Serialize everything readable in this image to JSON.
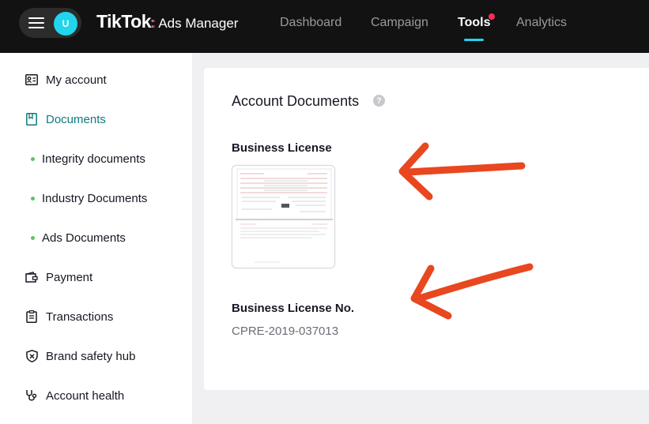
{
  "header": {
    "avatar_letter": "U",
    "logo_main": "TikTok",
    "logo_colon": ":",
    "logo_sub": "Ads Manager",
    "nav": [
      {
        "label": "Dashboard",
        "active": false
      },
      {
        "label": "Campaign",
        "active": false
      },
      {
        "label": "Tools",
        "active": true,
        "has_notification_dot": true
      },
      {
        "label": "Analytics",
        "active": false
      }
    ]
  },
  "sidebar": {
    "items": [
      {
        "label": "My account",
        "icon": "id-card-icon"
      },
      {
        "label": "Documents",
        "icon": "document-icon",
        "active": true
      },
      {
        "label": "Integrity documents",
        "sub": true
      },
      {
        "label": "Industry Documents",
        "sub": true
      },
      {
        "label": "Ads Documents",
        "sub": true
      },
      {
        "label": "Payment",
        "icon": "wallet-icon"
      },
      {
        "label": "Transactions",
        "icon": "clipboard-icon"
      },
      {
        "label": "Brand safety hub",
        "icon": "shield-icon"
      },
      {
        "label": "Account health",
        "icon": "stethoscope-icon"
      }
    ]
  },
  "main": {
    "title": "Account Documents",
    "help_glyph": "?",
    "license_label": "Business License",
    "license_no_label": "Business License No.",
    "license_no_value": "CPRE-2019-037013"
  },
  "colors": {
    "accent_teal": "#20d5ec",
    "active_text": "#0f7a7f",
    "notification": "#fe2c55",
    "arrow": "#e8471f"
  }
}
